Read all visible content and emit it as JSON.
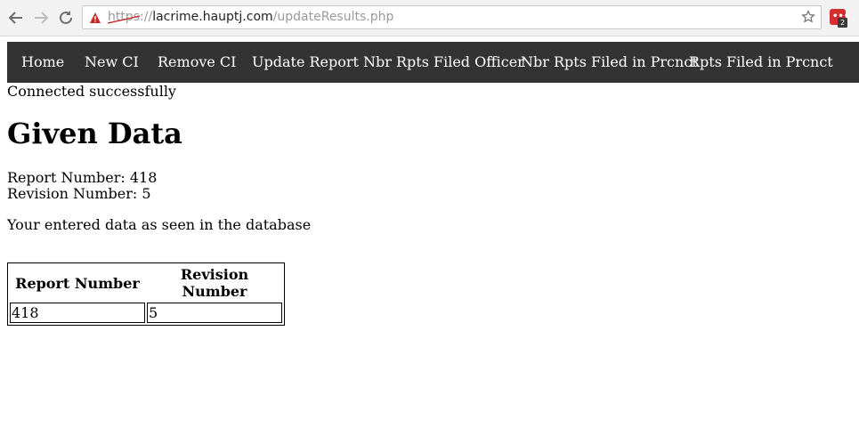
{
  "browser": {
    "url_scheme": "https",
    "url_separator": "://",
    "url_host": "lacrime.hauptj.com",
    "url_path": "/updateResults.php",
    "extension_badge": "2",
    "warning_color": "#c62828"
  },
  "nav": {
    "items": [
      {
        "label": "Home"
      },
      {
        "label": "New CI"
      },
      {
        "label": "Remove CI"
      },
      {
        "label": "Update Report"
      },
      {
        "label": "Nbr Rpts Filed Officer"
      },
      {
        "label": "Nbr Rpts Filed in Prcnct"
      },
      {
        "label": "Rpts Filed in Prcnct"
      }
    ],
    "background": "#333333"
  },
  "status_text": "Connected successfully",
  "heading": "Given Data",
  "given": {
    "report_line": "Report Number: 418",
    "revision_line": "Revision Number: 5"
  },
  "entered_text": "Your entered data as seen in the database",
  "results_table": {
    "headers": [
      "Report Number",
      "Revision Number"
    ],
    "rows": [
      [
        "418",
        "5"
      ]
    ]
  }
}
